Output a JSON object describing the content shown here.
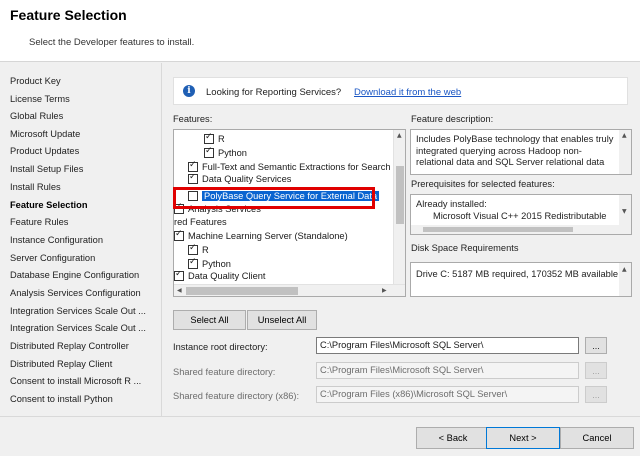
{
  "header": {
    "title": "Feature Selection",
    "subtitle": "Select the Developer features to install."
  },
  "sidebar": {
    "items": [
      {
        "label": "Product Key"
      },
      {
        "label": "License Terms"
      },
      {
        "label": "Global Rules"
      },
      {
        "label": "Microsoft Update"
      },
      {
        "label": "Product Updates"
      },
      {
        "label": "Install Setup Files"
      },
      {
        "label": "Install Rules"
      },
      {
        "label": "Feature Selection",
        "active": true
      },
      {
        "label": "Feature Rules"
      },
      {
        "label": "Instance Configuration"
      },
      {
        "label": "Server Configuration"
      },
      {
        "label": "Database Engine Configuration"
      },
      {
        "label": "Analysis Services Configuration"
      },
      {
        "label": "Integration Services Scale Out ..."
      },
      {
        "label": "Integration Services Scale Out ..."
      },
      {
        "label": "Distributed Replay Controller"
      },
      {
        "label": "Distributed Replay Client"
      },
      {
        "label": "Consent to install Microsoft R ..."
      },
      {
        "label": "Consent to install Python"
      }
    ]
  },
  "info": {
    "icon": "info-icon",
    "text": "Looking for Reporting Services?",
    "link": "Download it from the web"
  },
  "features": {
    "label": "Features:",
    "rows": [
      {
        "label": "R",
        "checked": true
      },
      {
        "label": "Python",
        "checked": true
      },
      {
        "label": "Full-Text and Semantic Extractions for Search",
        "checked": true
      },
      {
        "label": "Data Quality Services",
        "checked": true
      },
      {
        "label": "PolyBase Query Service for External Data",
        "checked": false,
        "selected": true
      },
      {
        "label": "Analysis Services",
        "checked": true
      },
      {
        "label": "red Features",
        "checked": null
      },
      {
        "label": "Machine Learning Server (Standalone)",
        "checked": true
      },
      {
        "label": "R",
        "checked": true
      },
      {
        "label": "Python",
        "checked": true
      },
      {
        "label": "Data Quality Client",
        "checked": true
      }
    ]
  },
  "description": {
    "label": "Feature description:",
    "text": "Includes PolyBase technology that enables truly integrated querying across Hadoop non-relational data and SQL Server relational data"
  },
  "prerequisites": {
    "label": "Prerequisites for selected features:",
    "heading": "Already installed:",
    "item": "Microsoft Visual C++ 2015 Redistributable"
  },
  "disk": {
    "label": "Disk Space Requirements",
    "text": "Drive C: 5187 MB required, 170352 MB available"
  },
  "buttons": {
    "select_all": "Select All",
    "unselect_all": "Unselect All",
    "browse": "..."
  },
  "directories": {
    "instance_root": {
      "label": "Instance root directory:",
      "value": "C:\\Program Files\\Microsoft SQL Server\\"
    },
    "shared": {
      "label": "Shared feature directory:",
      "value": "C:\\Program Files\\Microsoft SQL Server\\"
    },
    "shared_x86": {
      "label": "Shared feature directory (x86):",
      "value": "C:\\Program Files (x86)\\Microsoft SQL Server\\"
    }
  },
  "footer": {
    "back": "< Back",
    "next": "Next >",
    "cancel": "Cancel"
  }
}
